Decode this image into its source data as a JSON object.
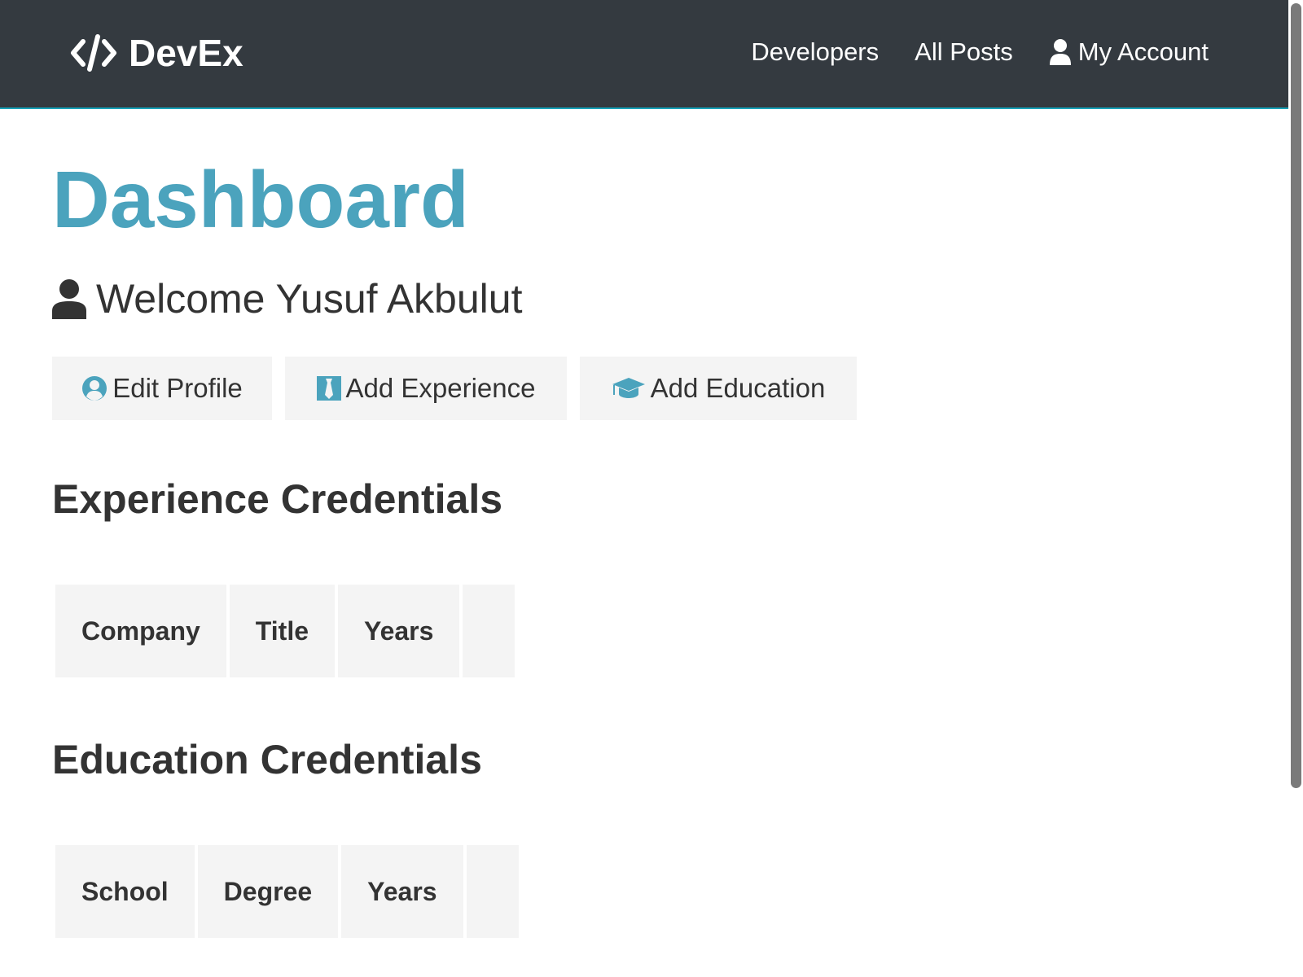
{
  "navbar": {
    "brand": "DevEx",
    "links": [
      {
        "label": "Developers"
      },
      {
        "label": "All Posts"
      },
      {
        "label": "My Account"
      }
    ]
  },
  "page": {
    "title": "Dashboard",
    "welcome": "Welcome Yusuf Akbulut"
  },
  "actions": {
    "edit_profile": "Edit Profile",
    "add_experience": "Add Experience",
    "add_education": "Add Education"
  },
  "experience": {
    "heading": "Experience Credentials",
    "columns": [
      "Company",
      "Title",
      "Years",
      ""
    ]
  },
  "education": {
    "heading": "Education Credentials",
    "columns": [
      "School",
      "Degree",
      "Years",
      ""
    ]
  },
  "colors": {
    "navbar_bg": "#343a40",
    "accent": "#4ba3bd",
    "button_bg": "#f4f4f4",
    "text": "#333333"
  },
  "icons": {
    "brand": "code-icon",
    "account": "user-icon",
    "welcome": "user-icon",
    "edit_profile": "user-circle-icon",
    "add_experience": "black-tie-icon",
    "add_education": "graduation-cap-icon"
  }
}
